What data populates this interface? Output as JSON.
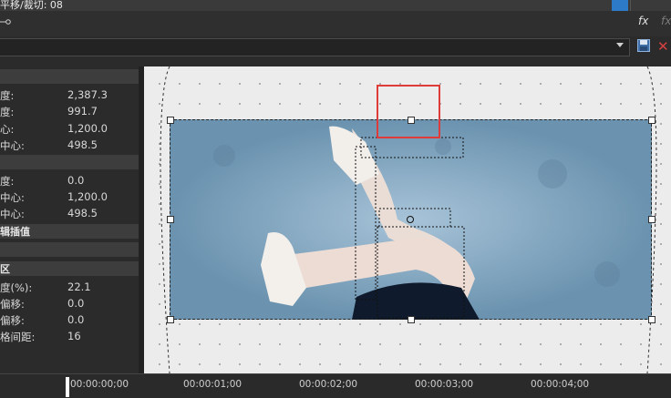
{
  "window": {
    "title": "平移/裁切: 08"
  },
  "toolbar": {
    "fx_label": "fx",
    "fx_label2": "fx"
  },
  "preset": {
    "value": ""
  },
  "properties": {
    "sections": [
      {
        "title": ""
      },
      {
        "title": ""
      },
      {
        "title": "辑插值"
      },
      {
        "title": ""
      },
      {
        "title": "区"
      }
    ],
    "rows": [
      {
        "label": "度:",
        "value": "2,387.3"
      },
      {
        "label": "度:",
        "value": "991.7"
      },
      {
        "label": "心:",
        "value": "1,200.0"
      },
      {
        "label": "中心:",
        "value": "498.5"
      },
      {
        "label": "度:",
        "value": "0.0"
      },
      {
        "label": "中心:",
        "value": "1,200.0"
      },
      {
        "label": "中心:",
        "value": "498.5"
      },
      {
        "label": "度(%):",
        "value": "22.1"
      },
      {
        "label": "偏移:",
        "value": "0.0"
      },
      {
        "label": "偏移:",
        "value": "0.0"
      },
      {
        "label": "格间距:",
        "value": "16"
      }
    ]
  },
  "timeline": {
    "ticks": [
      "00:00:00;00",
      "00:00:01;00",
      "00:00:02;00",
      "00:00:03;00",
      "00:00:04;00"
    ]
  },
  "colors": {
    "accent": "#2d7ac9",
    "highlight": "#e03b3b",
    "delete": "#d64040"
  },
  "icons": [
    "keyframe-icon",
    "fx-icon",
    "save-icon",
    "delete-icon",
    "dropdown-arrow-icon",
    "playhead-icon"
  ]
}
